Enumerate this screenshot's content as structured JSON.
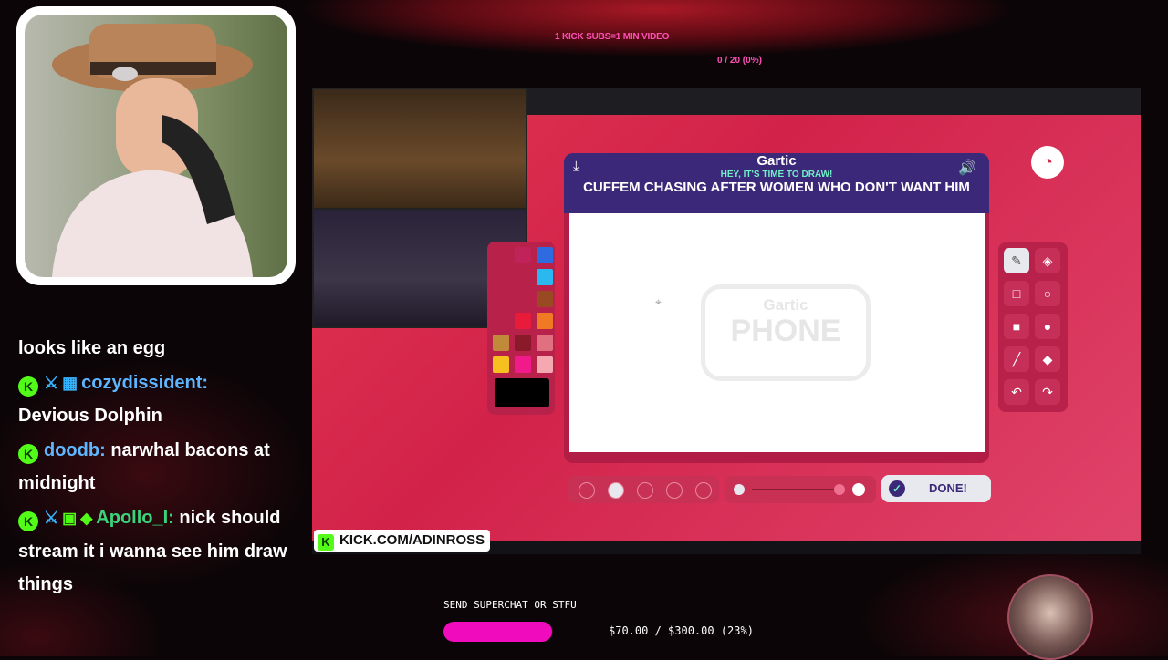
{
  "overlay": {
    "top_banner": "1 KICK SUBS=1 MIN VIDEO",
    "sub_count": "0 / 20 (0%)",
    "stream_url": "KICK.COM/ADINROSS",
    "superchat_label": "SEND SUPERCHAT OR STFU",
    "goal_amount": "$70.00 / $300.00 (23%)",
    "goal_fraction": 0.23
  },
  "chat": [
    {
      "user": "",
      "message": "looks like an egg"
    },
    {
      "user": "cozydissident:",
      "message": "Devious Dolphin"
    },
    {
      "user": "doodb:",
      "message": "narwhal bacons at midnight"
    },
    {
      "user": "Apollo_I:",
      "message": "nick should stream it i wanna see him draw things"
    }
  ],
  "game": {
    "logo": "Gartic",
    "subtitle": "HEY, IT'S TIME TO DRAW!",
    "prompt": "CUFFEM CHASING AFTER WOMEN WHO DON'T WANT HIM",
    "watermark_top": "Gartic",
    "watermark_bottom": "PHONE",
    "done_label": "DONE!"
  },
  "icons": {
    "download": "download-icon",
    "speaker": "speaker-icon",
    "timer": "timer-icon",
    "pencil": "pencil-icon",
    "eraser": "eraser-icon"
  },
  "colors": {
    "accent_pink": "#ff4fb6",
    "kick_green": "#53fc18",
    "game_purple": "#3c2878",
    "progress_magenta": "#f00bbd"
  }
}
